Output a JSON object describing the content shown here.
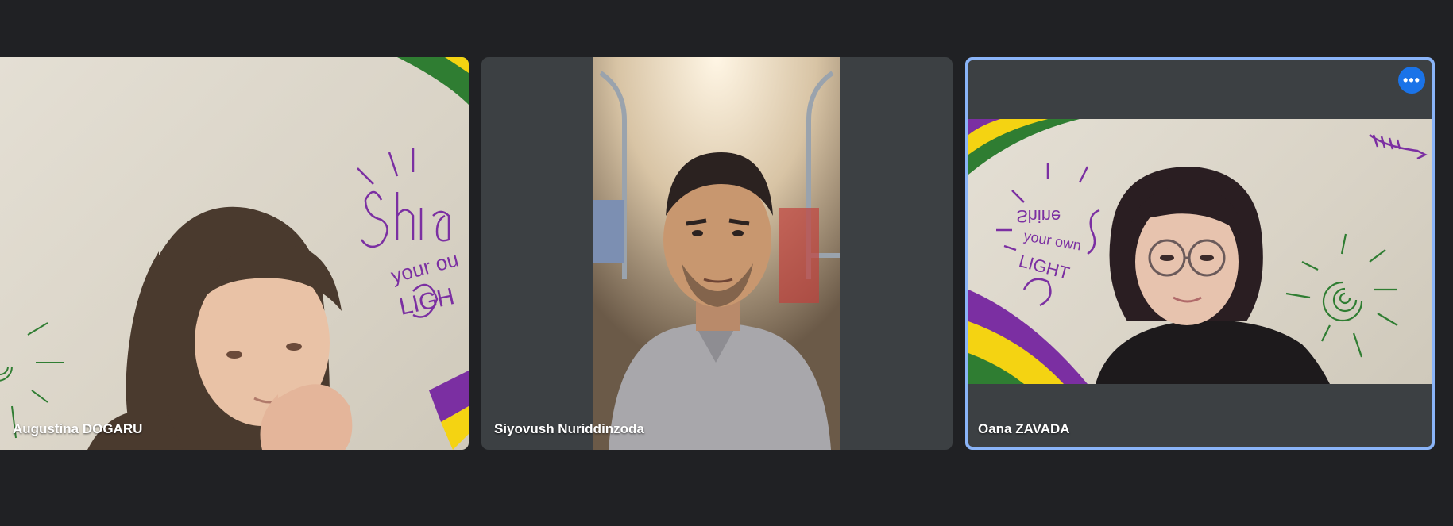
{
  "participants": [
    {
      "name": "Augustina DOGARU"
    },
    {
      "name": "Siyovush Nuriddinzoda"
    },
    {
      "name": "Oana ZAVADA",
      "active_speaker": true
    }
  ],
  "more_options_icon": "more-horiz-icon",
  "colors": {
    "background": "#202124",
    "tile": "#3c4043",
    "speaker_border": "#8ab4f8",
    "more_button": "#1a73e8"
  }
}
